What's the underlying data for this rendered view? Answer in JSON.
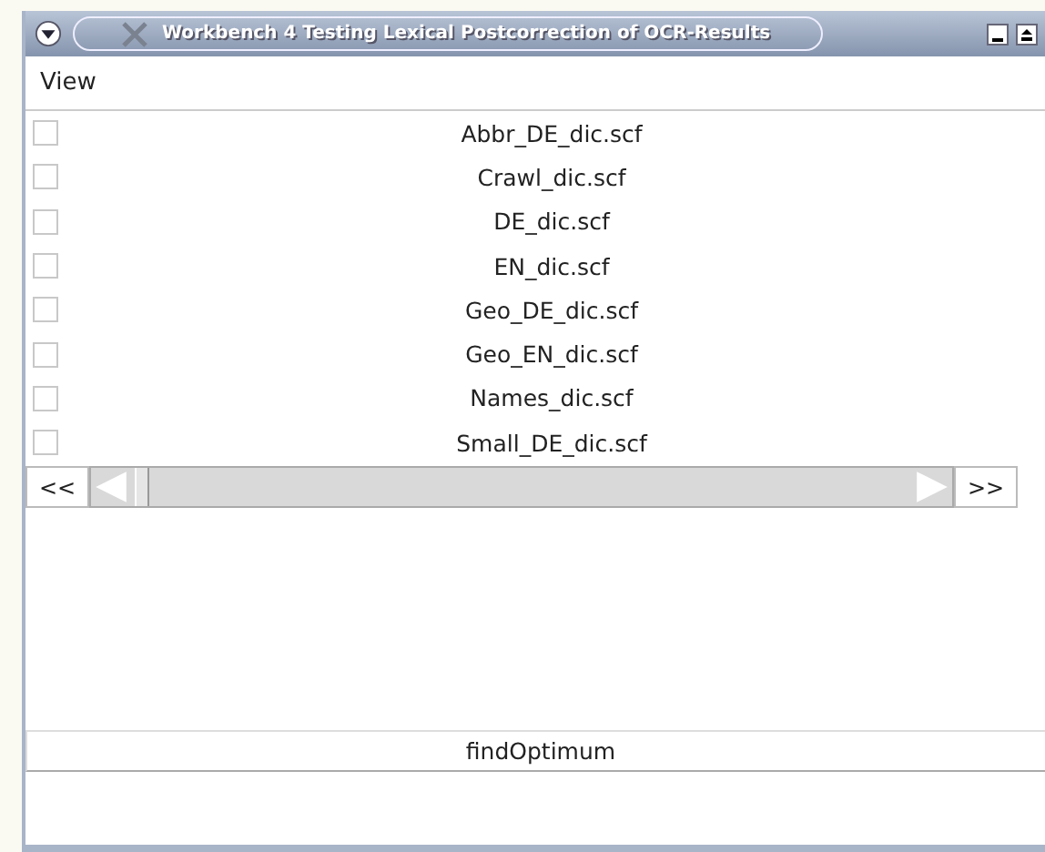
{
  "window": {
    "title": "Workbench 4 Testing Lexical Postcorrection of OCR-Results"
  },
  "menu": [
    "View"
  ],
  "dictionaries": [
    {
      "name": "Abbr_DE_dic.scf",
      "checked": false
    },
    {
      "name": "Crawl_dic.scf",
      "checked": false
    },
    {
      "name": "DE_dic.scf",
      "checked": false
    },
    {
      "name": "EN_dic.scf",
      "checked": false
    },
    {
      "name": "Geo_DE_dic.scf",
      "checked": false
    },
    {
      "name": "Geo_EN_dic.scf",
      "checked": false
    },
    {
      "name": "Names_dic.scf",
      "checked": false
    },
    {
      "name": "Small_DE_dic.scf",
      "checked": false
    }
  ],
  "scroller": {
    "back": "<<",
    "forward": ">>"
  },
  "buttons": [
    "findOptimum"
  ]
}
